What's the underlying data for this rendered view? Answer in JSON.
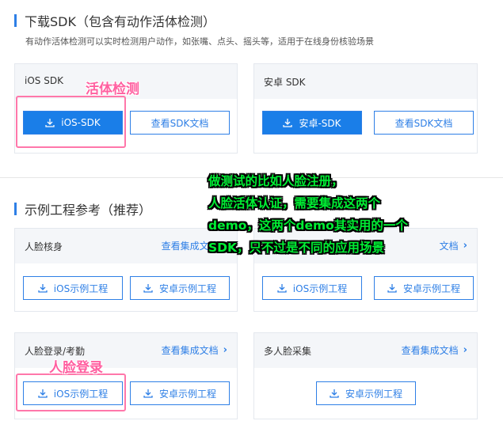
{
  "section1": {
    "title": "下载SDK（包含有动作活体检测）",
    "desc": "有动作活体检测可以实时检测用户动作，如张嘴、点头、摇头等，适用于在线身份核验场景"
  },
  "sdk_cards": [
    {
      "title": "iOS SDK",
      "primary_label": "iOS-SDK",
      "outline_label": "查看SDK文档"
    },
    {
      "title": "安卓 SDK",
      "primary_label": "安卓-SDK",
      "outline_label": "查看SDK文档"
    }
  ],
  "section2": {
    "title": "示例工程参考（推荐）"
  },
  "demo_cards": [
    {
      "title": "人脸核身",
      "link": "查看集成文档",
      "ios_label": "iOS示例工程",
      "android_label": "安卓示例工程"
    },
    {
      "title": "",
      "link": "文档",
      "ios_label": "iOS示例工程",
      "android_label": "安卓示例工程"
    },
    {
      "title": "人脸登录/考勤",
      "link": "查看集成文档",
      "ios_label": "iOS示例工程",
      "android_label": "安卓示例工程"
    },
    {
      "title": "多人脸采集",
      "link": "查看集成文档",
      "android_label": "安卓示例工程"
    }
  ],
  "annotations": {
    "liveness_label": "活体检测",
    "face_login_label": "人脸登录",
    "note_lines": [
      "做测试的比如人脸注册，",
      "人脸活体认证，需要集成这两个",
      "demo，这两个demo其实用的一个",
      "SDK，只不过是不同的应用场景"
    ]
  },
  "colors": {
    "accent": "#2e7fe6",
    "primary_btn": "#1a7ee8",
    "highlight": "#ff77aa",
    "note": "#00ee33"
  },
  "icons": {
    "download": "download-icon",
    "chevron": "chevron-right-icon"
  }
}
